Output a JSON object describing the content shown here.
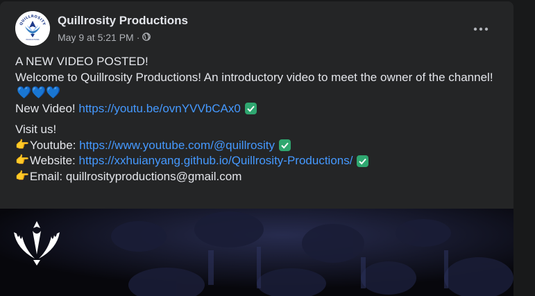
{
  "post": {
    "page_name": "Quillrosity Productions",
    "timestamp": "May 9 at 5:21 PM",
    "separator": "·",
    "audience_icon": "globe-icon",
    "more_icon": "more-horizontal-icon",
    "avatar_logo_text": "QUILLROSITY",
    "avatar_logo_subtext": "PRODUCTIONS",
    "lines": {
      "headline": "A NEW VIDEO POSTED!",
      "welcome": "Welcome to Quillrosity Productions! An introductory video to meet the owner of the channel!",
      "hearts": "💙💙💙",
      "new_video_label": "New Video! ",
      "new_video_url": "https://youtu.be/ovnYVVbCAx0",
      "visit": "Visit us!",
      "youtube_label": "Youtube: ",
      "youtube_url": "https://www.youtube.com/@quillrosity",
      "website_label": "Website: ",
      "website_url": "https://xxhuianyang.github.io/Quillrosity-Productions/",
      "email_label": "Email: ",
      "email_value": "quillrosityproductions@gmail.com",
      "pointer": "👉"
    }
  },
  "colors": {
    "background": "#18191a",
    "card": "#242526",
    "text": "#e4e6eb",
    "secondary_text": "#b0b3b8",
    "link": "#4599ff",
    "check": "#2fa770"
  }
}
